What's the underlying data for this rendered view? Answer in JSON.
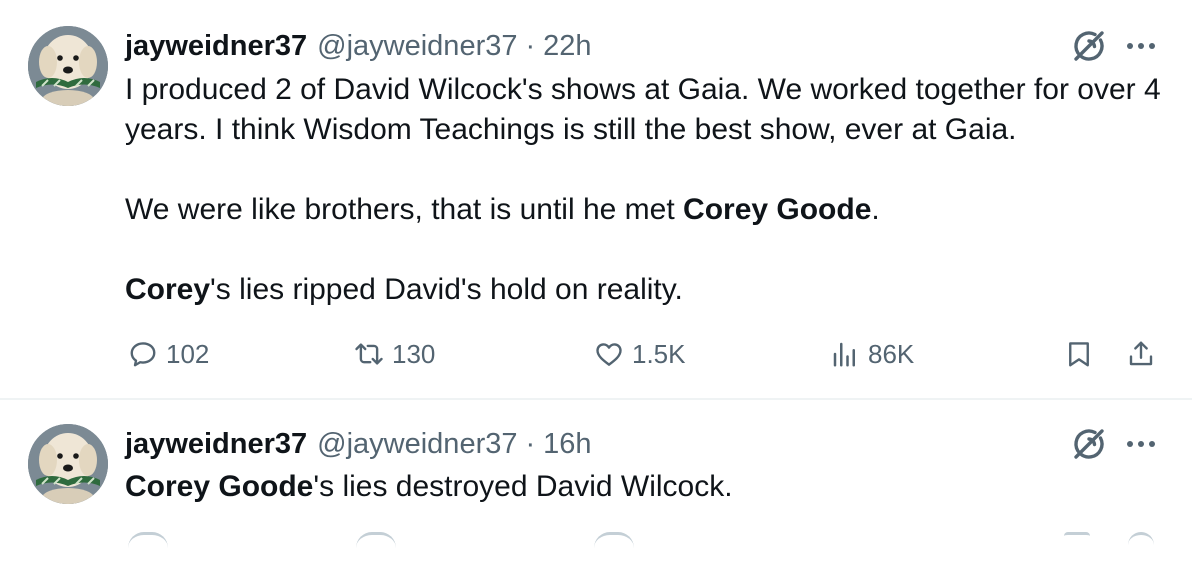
{
  "tweets": [
    {
      "display_name": "jayweidner37",
      "handle": "@jayweidner37",
      "separator": "·",
      "time": "22h",
      "paragraphs": [
        [
          {
            "text": "I produced 2 of David Wilcock's shows at Gaia.  We worked together for over 4 years.  I think Wisdom Teachings is still the best show, ever at Gaia.",
            "bold": false
          }
        ],
        [],
        [
          {
            "text": "We were like brothers, that is until he met ",
            "bold": false
          },
          {
            "text": "Corey Goode",
            "bold": true
          },
          {
            "text": ".",
            "bold": false
          }
        ],
        [],
        [
          {
            "text": "Corey",
            "bold": true
          },
          {
            "text": "'s lies ripped David's hold on reality.",
            "bold": false
          }
        ]
      ],
      "actions": {
        "replies": "102",
        "reposts": "130",
        "likes": "1.5K",
        "views": "86K"
      }
    },
    {
      "display_name": "jayweidner37",
      "handle": "@jayweidner37",
      "separator": "·",
      "time": "16h",
      "paragraphs": [
        [
          {
            "text": "Corey Goode",
            "bold": true
          },
          {
            "text": "'s lies destroyed David Wilcock.",
            "bold": false
          }
        ]
      ]
    }
  ],
  "icons": {
    "grok": "grok-icon",
    "more": "more-icon",
    "reply": "reply-icon",
    "repost": "repost-icon",
    "like": "like-icon",
    "views": "views-icon",
    "bookmark": "bookmark-icon",
    "share": "share-icon"
  },
  "colors": {
    "text": "#0f1419",
    "secondary": "#536471",
    "divider": "#eff3f4"
  }
}
